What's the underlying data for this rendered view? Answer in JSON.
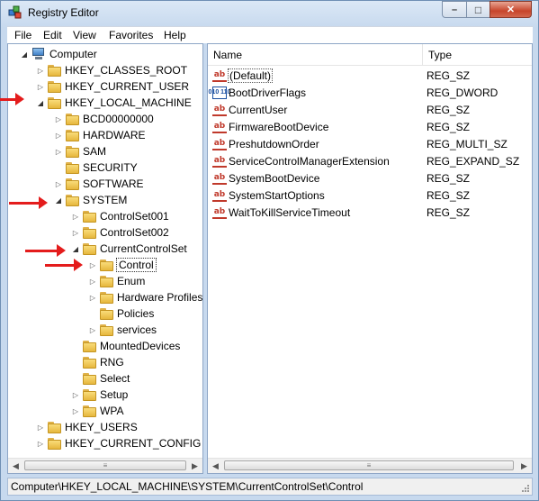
{
  "window": {
    "title": "Registry Editor"
  },
  "menu": [
    "File",
    "Edit",
    "View",
    "Favorites",
    "Help"
  ],
  "tree": [
    {
      "label": "Computer",
      "level": 0,
      "icon": "computer",
      "expander": "open"
    },
    {
      "label": "HKEY_CLASSES_ROOT",
      "level": 1,
      "expander": "closed"
    },
    {
      "label": "HKEY_CURRENT_USER",
      "level": 1,
      "expander": "closed"
    },
    {
      "label": "HKEY_LOCAL_MACHINE",
      "level": 1,
      "expander": "open"
    },
    {
      "label": "BCD00000000",
      "level": 2,
      "expander": "closed"
    },
    {
      "label": "HARDWARE",
      "level": 2,
      "expander": "closed"
    },
    {
      "label": "SAM",
      "level": 2,
      "expander": "closed"
    },
    {
      "label": "SECURITY",
      "level": 2,
      "expander": "none"
    },
    {
      "label": "SOFTWARE",
      "level": 2,
      "expander": "closed"
    },
    {
      "label": "SYSTEM",
      "level": 2,
      "expander": "open"
    },
    {
      "label": "ControlSet001",
      "level": 3,
      "expander": "closed"
    },
    {
      "label": "ControlSet002",
      "level": 3,
      "expander": "closed"
    },
    {
      "label": "CurrentControlSet",
      "level": 3,
      "expander": "open"
    },
    {
      "label": "Control",
      "level": 4,
      "expander": "closed",
      "selected": true
    },
    {
      "label": "Enum",
      "level": 4,
      "expander": "closed"
    },
    {
      "label": "Hardware Profiles",
      "level": 4,
      "expander": "closed"
    },
    {
      "label": "Policies",
      "level": 4,
      "expander": "none"
    },
    {
      "label": "services",
      "level": 4,
      "expander": "closed"
    },
    {
      "label": "MountedDevices",
      "level": 3,
      "expander": "none"
    },
    {
      "label": "RNG",
      "level": 3,
      "expander": "none"
    },
    {
      "label": "Select",
      "level": 3,
      "expander": "none"
    },
    {
      "label": "Setup",
      "level": 3,
      "expander": "closed"
    },
    {
      "label": "WPA",
      "level": 3,
      "expander": "closed"
    },
    {
      "label": "HKEY_USERS",
      "level": 1,
      "expander": "closed"
    },
    {
      "label": "HKEY_CURRENT_CONFIG",
      "level": 1,
      "expander": "closed"
    }
  ],
  "columns": {
    "name": "Name",
    "type": "Type"
  },
  "values": [
    {
      "name": "(Default)",
      "type": "REG_SZ",
      "icon": "string-value-icon"
    },
    {
      "name": "BootDriverFlags",
      "type": "REG_DWORD",
      "icon": "dword-value-icon"
    },
    {
      "name": "CurrentUser",
      "type": "REG_SZ",
      "icon": "string-value-icon"
    },
    {
      "name": "FirmwareBootDevice",
      "type": "REG_SZ",
      "icon": "string-value-icon"
    },
    {
      "name": "PreshutdownOrder",
      "type": "REG_MULTI_SZ",
      "icon": "string-value-icon"
    },
    {
      "name": "ServiceControlManagerExtension",
      "type": "REG_EXPAND_SZ",
      "icon": "string-value-icon"
    },
    {
      "name": "SystemBootDevice",
      "type": "REG_SZ",
      "icon": "string-value-icon"
    },
    {
      "name": "SystemStartOptions",
      "type": "REG_SZ",
      "icon": "string-value-icon"
    },
    {
      "name": "WaitToKillServiceTimeout",
      "type": "REG_SZ",
      "icon": "string-value-icon"
    }
  ],
  "status": {
    "path": "Computer\\HKEY_LOCAL_MACHINE\\SYSTEM\\CurrentControlSet\\Control"
  },
  "glyphs": {
    "sz": "ab",
    "dword": "010 110",
    "minimize": "–",
    "maximize": "□",
    "close": "✕",
    "scroll_left": "◀",
    "scroll_right": "▶",
    "grip": "≡"
  },
  "colors": {
    "annotation_arrow": "#e41c1c",
    "sz_icon": "#c0392b",
    "dword_icon": "#1a4fa0"
  }
}
